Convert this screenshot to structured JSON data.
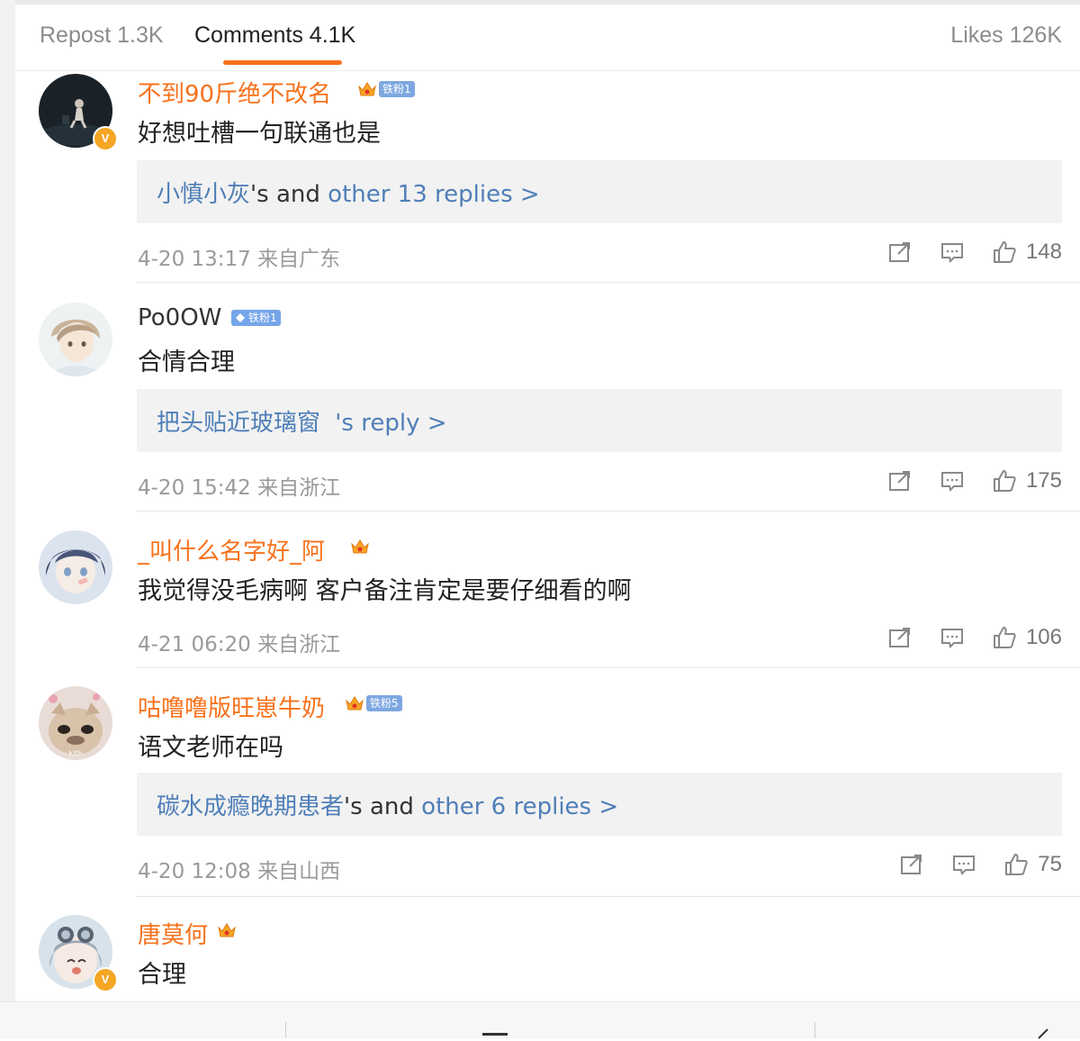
{
  "tabs": {
    "repost": "Repost 1.3K",
    "comments": "Comments 4.1K",
    "likes": "Likes 126K",
    "active": "comments"
  },
  "colors": {
    "accent": "#f7711b",
    "link": "#4f7fb8",
    "vip_name": "#f7711b"
  },
  "comments": [
    {
      "username": "不到90斤绝不改名",
      "vip": true,
      "fan_badge": "铁粉1",
      "verified": true,
      "text": "好想吐槽一句联通也是",
      "reply_user": "小慎小灰",
      "reply_mid": "'s and ",
      "reply_more": "other 13 replies >",
      "time": "4-20 13:17 来自广东",
      "likes": "148"
    },
    {
      "username": "Po0OW",
      "vip": false,
      "fan_badge": "铁粉1",
      "verified": false,
      "text": "合情合理",
      "reply_user": "把头贴近玻璃窗",
      "reply_more": " 's reply >",
      "time": "4-20 15:42 来自浙江",
      "likes": "175"
    },
    {
      "username": "_叫什么名字好_阿",
      "vip": true,
      "verified": false,
      "text": "我觉得没毛病啊 客户备注肯定是要仔细看的啊",
      "time": "4-21 06:20 来自浙江",
      "likes": "106"
    },
    {
      "username": "咕噜噜版旺崽牛奶",
      "vip": true,
      "fan_badge": "铁粉5",
      "verified": false,
      "avatar_text": "kith",
      "text": "语文老师在吗",
      "reply_user": "碳水成瘾晚期患者",
      "reply_mid": "'s and ",
      "reply_more": "other 6 replies >",
      "time": "4-20 12:08 来自山西",
      "likes": "75"
    },
    {
      "username": "唐莫何",
      "vip": true,
      "verified": true,
      "text": "合理"
    }
  ],
  "icons": {
    "share": "share-icon",
    "comment": "comment-icon",
    "like": "thumbs-up-icon",
    "vip": "crown-icon",
    "verified": "verified-icon"
  }
}
